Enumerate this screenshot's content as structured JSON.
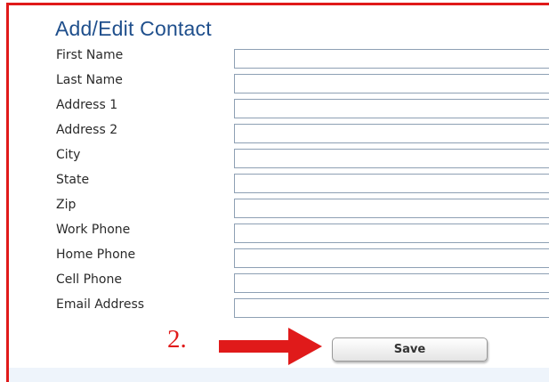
{
  "form": {
    "title": "Add/Edit Contact",
    "fields": [
      {
        "label": "First Name",
        "value": ""
      },
      {
        "label": "Last Name",
        "value": ""
      },
      {
        "label": "Address 1",
        "value": ""
      },
      {
        "label": "Address 2",
        "value": ""
      },
      {
        "label": "City",
        "value": ""
      },
      {
        "label": "State",
        "value": ""
      },
      {
        "label": "Zip",
        "value": ""
      },
      {
        "label": "Work Phone",
        "value": ""
      },
      {
        "label": "Home Phone",
        "value": ""
      },
      {
        "label": "Cell Phone",
        "value": ""
      },
      {
        "label": "Email Address",
        "value": ""
      }
    ],
    "save_label": "Save"
  },
  "annotation": {
    "step_label": "2.",
    "arrow_icon": "right-arrow-icon",
    "color": "#e01a1a"
  },
  "colors": {
    "title": "#1f4f8c",
    "highlight_border": "#e01a1a",
    "footer_strip": "#eef4fb"
  }
}
